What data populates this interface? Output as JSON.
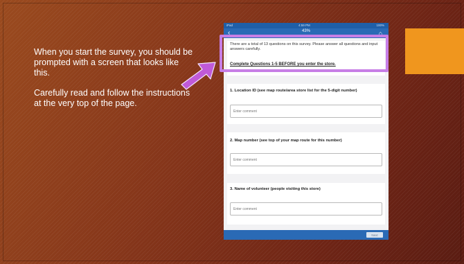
{
  "slide": {
    "paragraphs": [
      "When you start the survey, you should be prompted with a screen that looks like this.",
      "Carefully read and follow the instructions at the very top of the page."
    ],
    "colors": {
      "accent_box": "#f0961e",
      "highlight": "#c77ee6",
      "arrow": "#c05ad8"
    }
  },
  "phone": {
    "status": {
      "carrier": "iPad",
      "time": "4:59 PM",
      "battery": "100%"
    },
    "nav": {
      "back": "‹",
      "progress_label": "43%",
      "progress_value": 0.43,
      "home_icon": "home-icon"
    },
    "intro": {
      "text": "There are a total of 13 questions on this survey. Please answer all questions and input answers carefully.",
      "bold": "Complete Questions 1-5 BEFORE you enter the store."
    },
    "questions": [
      {
        "label": "1. Location ID (see map route/area store list for the 5-digit number)",
        "placeholder": "Enter comment"
      },
      {
        "label": "2. Map number (see top of your map route for this number)",
        "placeholder": "Enter comment"
      },
      {
        "label": "3. Name of volunteer (people visiting this store)",
        "placeholder": "Enter comment"
      }
    ],
    "next_label": "Next"
  }
}
